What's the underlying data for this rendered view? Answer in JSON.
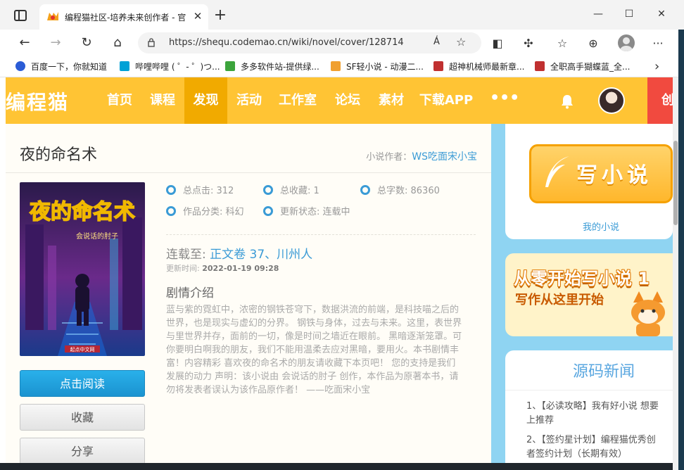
{
  "browser": {
    "tab_title": "编程猫社区-培养未来创作者 - 官",
    "url": "https://shequ.codemao.cn/wiki/novel/cover/128714",
    "read_aloud": "A̒",
    "new_tab": "+",
    "close_tab": "✕",
    "window": {
      "minimize": "—",
      "maximize": "☐",
      "close": "✕"
    }
  },
  "bookmarks": [
    {
      "label": "百度一下，你就知道",
      "color": "#2b5cd6"
    },
    {
      "label": "哔哩哔哩 ( ゜- ゜)つ...",
      "color": "#00a1d6"
    },
    {
      "label": "多多软件站-提供绿...",
      "color": "#3ca43c"
    },
    {
      "label": "SF轻小说 - 动漫二...",
      "color": "#f0a030"
    },
    {
      "label": "超神机械师最新章...",
      "color": "#c03030"
    },
    {
      "label": "全职高手猢蝶蓝_全...",
      "color": "#c03030"
    }
  ],
  "site": {
    "logo": "编程猫",
    "nav": [
      "首页",
      "课程",
      "发现",
      "活动",
      "工作室",
      "论坛",
      "素材",
      "下载APP"
    ],
    "nav_more": "•••",
    "create_label": "创"
  },
  "novel": {
    "title": "夜的命名术",
    "author_label": "小说作者：",
    "author": "WS吃面宋小宝",
    "stats": {
      "clicks": "总点击: 312",
      "favorites": "总收藏: 1",
      "words": "总字数: 86360",
      "category": "作品分类: 科幻",
      "status": "更新状态: 连载中"
    },
    "latest_label": "连载至: ",
    "latest_chapter": "正文卷 37、川州人",
    "update_label": "更新时间: ",
    "update_time": "2022-01-19 09:28",
    "synopsis_heading": "剧情介绍",
    "synopsis": "蓝与紫的霓虹中，浓密的钢铁苍穹下，数据洪流的前端，是科技喵之后的世界，也是现实与虚幻的分界。 钢铁与身体，过去与未来。这里，表世界与里世界并存，面前的一切，像是时间之墙近在眼前。 黑暗逐渐笼罩。可你要明白啊我的朋友，我们不能用温柔去应对黑暗，要用火。本书剧情丰富！内容精彩 喜欢夜的命名术的朋友请收藏下本页吧！ 您的支持是我们发展的动力 声明：该小说由 会说话的肘子 创作，本作品为原著本书，请勿将发表者误认为该作品原作者！ ——吃面宋小宝",
    "cover": {
      "title_art": "夜的命名术",
      "author": "会说话的肘子",
      "publisher": "起点中文网"
    },
    "buttons": {
      "read": "点击阅读",
      "favorite": "收藏",
      "share": "分享"
    }
  },
  "sidebar": {
    "write_banner": "写小说",
    "my_novels": "我的小说",
    "promo_line1": "从零开始写小说 1",
    "promo_line2": "写作从这里开始",
    "news_title": "源码新闻",
    "news": [
      "1、【必读攻略】我有好小说 想要",
      "上推荐",
      "2、【签约星计划】编程猫优秀创",
      "者签约计划（长期有效）"
    ]
  },
  "colors": {
    "nav_bg": "#ffc434",
    "nav_active": "#f1aa00",
    "accent_blue": "#3a9bd6",
    "create_red": "#f14a3f",
    "page_bg": "#8fd4f2"
  }
}
